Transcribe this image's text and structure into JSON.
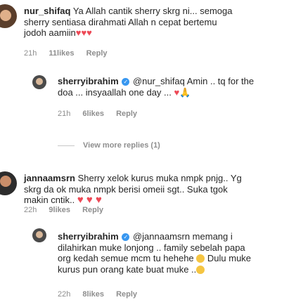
{
  "comments": [
    {
      "username": "nur_shifaq",
      "text_line1": " Ya Allah cantik sherry skrg ni... semoga",
      "text_line2": "sherry sentiasa dirahmati Allah n cepat bertemu",
      "text_line3": "jodoh aamiin",
      "hearts_suffix": "♥♥♥",
      "time": "21h",
      "likes": "11likes",
      "reply": "Reply"
    },
    {
      "username": "sherryibrahim",
      "verified_icon": "verified-badge-icon",
      "text_line1": " @nur_shifaq Amin .. tq for the",
      "text_line2": "doa ... insyaallah one day ... ",
      "time": "21h",
      "likes": "6likes",
      "reply": "Reply"
    },
    {
      "username": "jannaamsrn",
      "text_line1": " Sherry xelok kurus muka nmpk pnjg.. Yg",
      "text_line2": "skrg da ok muka nmpk berisi omeii sgt.. Suka tgok",
      "text_line3": "makin cntik.. ",
      "hearts": "♥ ♥ ♥",
      "time": "22h",
      "likes": "9likes",
      "reply": "Reply"
    },
    {
      "username": "sherryibrahim",
      "text_line1": " @jannaamsrn memang i",
      "text_line2": "dilahirkan muke lonjong .. family sebelah papa",
      "text_line3": "org kedah semue mcm tu hehehe ",
      "text_line3b": " Dulu muke",
      "text_line4": "kurus pun orang kate buat muke ..",
      "time": "22h",
      "likes": "8likes",
      "reply": "Reply"
    }
  ],
  "view_more_replies": "View more replies (1)",
  "colors": {
    "heart": "#ed4956",
    "meta": "#8e8e8e",
    "verified": "#3897f0"
  }
}
